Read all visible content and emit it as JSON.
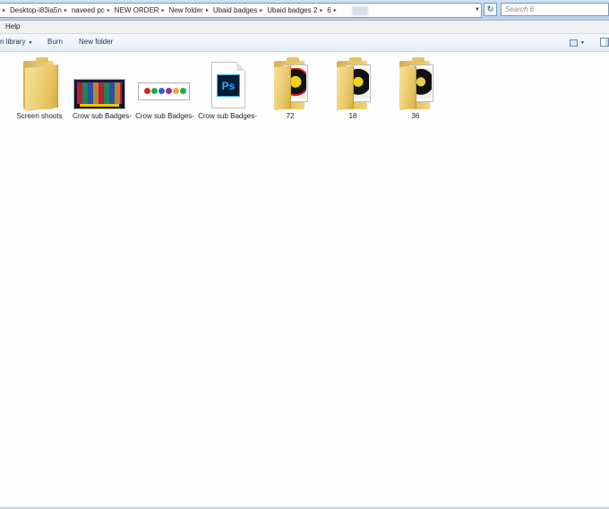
{
  "address_bar": {
    "breadcrumbs": [
      {
        "label": "Desktop-i83ia5n"
      },
      {
        "label": "naveed pc"
      },
      {
        "label": "NEW ORDER"
      },
      {
        "label": "New folder"
      },
      {
        "label": "Ubaid badges"
      },
      {
        "label": "Ubaid badges 2"
      },
      {
        "label": "6"
      }
    ]
  },
  "search": {
    "placeholder": "Search 6"
  },
  "menu": {
    "items": [
      {
        "label": "Help"
      }
    ]
  },
  "toolbar": {
    "include_library": "n library",
    "burn": "Burn",
    "new_folder": "New folder"
  },
  "files": [
    {
      "name": "Screen shoots",
      "type": "folder"
    },
    {
      "name": "Crow sub Badges-",
      "type": "image-dark"
    },
    {
      "name": "Crow sub Badges-",
      "type": "image-light"
    },
    {
      "name": "Crow sub Badges-",
      "type": "psd"
    },
    {
      "name": "72",
      "type": "folder-badge"
    },
    {
      "name": "18",
      "type": "folder-badge"
    },
    {
      "name": "36",
      "type": "folder-badge"
    }
  ],
  "icons": {
    "psd_label": "Ps"
  },
  "colors": {
    "chrome": "#b9d1ea",
    "folder": "#f0d47e",
    "ps_blue": "#31a8ff"
  }
}
